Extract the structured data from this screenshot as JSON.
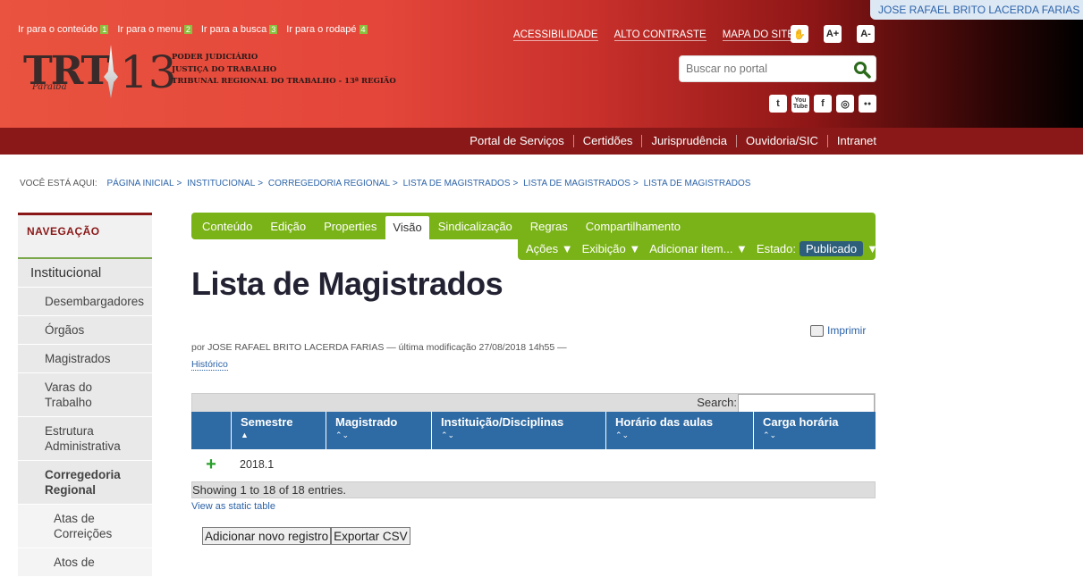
{
  "skip_links": [
    {
      "label": "Ir para o conteúdo",
      "key": "1"
    },
    {
      "label": "Ir para o menu",
      "key": "2"
    },
    {
      "label": "Ir para a busca",
      "key": "3"
    },
    {
      "label": "Ir para o rodapé",
      "key": "4"
    }
  ],
  "logo": {
    "trt": "TRT",
    "number": "13",
    "state": "Paraíba"
  },
  "org": {
    "line1": "PODER JUDICIÁRIO",
    "line2": "JUSTIÇA DO TRABALHO",
    "line3": "TRIBUNAL REGIONAL DO TRABALHO - 13ª REGIÃO"
  },
  "user": {
    "name": "JOSE RAFAEL BRITO LACERDA FARIAS ▼"
  },
  "top_links": [
    "ACESSIBILIDADE",
    "ALTO CONTRASTE",
    "MAPA DO SITE"
  ],
  "acc_icons": {
    "libras": "✋",
    "font_up": "A+",
    "font_down": "A-"
  },
  "search": {
    "placeholder": "Buscar no portal"
  },
  "social": [
    "t",
    "You Tube",
    "f",
    "◎",
    "●●"
  ],
  "main_menu": [
    "Portal de Serviços",
    "Certidões",
    "Jurisprudência",
    "Ouvidoria/SIC",
    "Intranet"
  ],
  "breadcrumb": {
    "label": "VOCÊ ESTÁ AQUI:",
    "items": [
      "PÁGINA INICIAL",
      "INSTITUCIONAL",
      "CORREGEDORIA REGIONAL",
      "LISTA DE MAGISTRADOS",
      "LISTA DE MAGISTRADOS",
      "LISTA DE MAGISTRADOS"
    ]
  },
  "nav": {
    "title": "NAVEGAÇÃO",
    "section": "Institucional",
    "items": [
      "Desembargadores",
      "Órgãos",
      "Magistrados",
      "Varas do Trabalho",
      "Estrutura Administrativa",
      "Corregedoria Regional"
    ],
    "subitems": [
      "Atas de Correições",
      "Atos de"
    ]
  },
  "edit_tabs": [
    "Conteúdo",
    "Edição",
    "Properties",
    "Visão",
    "Sindicalização",
    "Regras",
    "Compartilhamento"
  ],
  "edit_actions": {
    "acoes": "Ações ▼",
    "exibicao": "Exibição ▼",
    "adicionar": "Adicionar item... ▼",
    "estado_label": "Estado:",
    "estado": "Publicado",
    "estado_arrow": "▼"
  },
  "page": {
    "title": "Lista de Magistrados",
    "print": "Imprimir",
    "byline": "por JOSE RAFAEL BRITO LACERDA FARIAS — última modificação 27/08/2018 14h55 —",
    "history": "Histórico"
  },
  "table": {
    "search_label": "Search:",
    "columns": [
      {
        "label": "Semestre",
        "sort": "▲"
      },
      {
        "label": "Magistrado",
        "sort": "⌃⌄"
      },
      {
        "label": "Instituição/Disciplinas",
        "sort": "⌃⌄"
      },
      {
        "label": "Horário das aulas",
        "sort": "⌃⌄"
      },
      {
        "label": "Carga horária",
        "sort": "⌃⌄"
      }
    ],
    "rows": [
      {
        "expand": "+",
        "semestre": "2018.1"
      }
    ],
    "info": "Showing 1 to 18 of 18 entries.",
    "static_link": "View as static table"
  },
  "buttons": {
    "add": "Adicionar novo registro",
    "export": "Exportar CSV"
  }
}
